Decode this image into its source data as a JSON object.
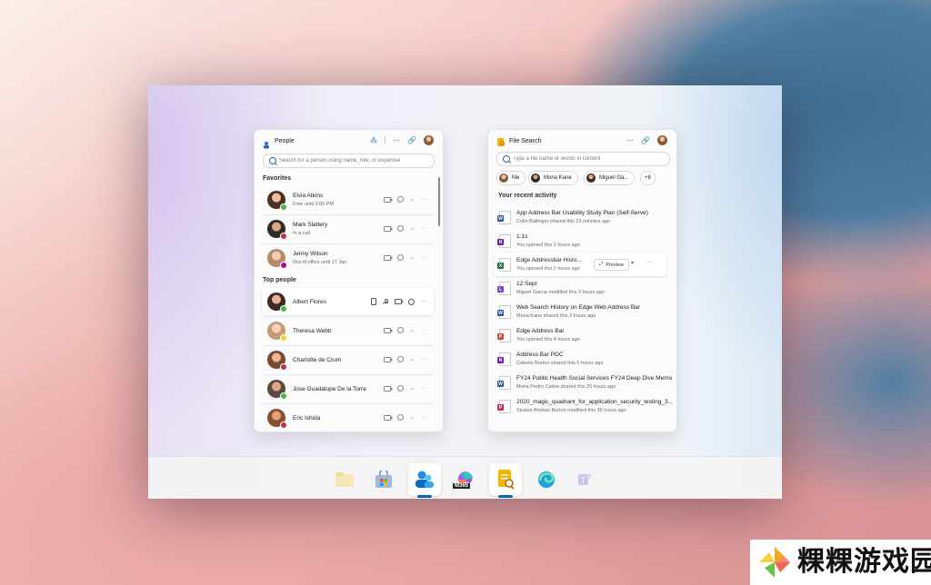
{
  "people": {
    "title": "People",
    "search_placeholder": "Search for a person using name, role, or expertise",
    "favorites_title": "Favorites",
    "favorites": [
      {
        "name": "Elvia Atkins",
        "status": "Free until 3:00 PM",
        "presence": "available"
      },
      {
        "name": "Mark Slattery",
        "status": "In a call",
        "presence": "busy"
      },
      {
        "name": "Jenny Wilson",
        "status": "Out of office until 17 Jan",
        "presence": "out-of-office"
      }
    ],
    "top_title": "Top people",
    "top": [
      {
        "name": "Albert Flores",
        "presence": "available"
      },
      {
        "name": "Theresa Webb",
        "presence": "away"
      },
      {
        "name": "Charlotte de Crum",
        "presence": "busy"
      },
      {
        "name": "Jose Guadalupe De la Torre",
        "presence": "available"
      },
      {
        "name": "Eric Ishida",
        "presence": "busy"
      }
    ]
  },
  "files": {
    "title": "File Search",
    "search_placeholder": "Type a file name or words in content",
    "chips": [
      "Me",
      "Mona Kane",
      "Miguel Ga...",
      "+8"
    ],
    "recent_title": "Your recent activity",
    "preview_label": "Preview",
    "items": [
      {
        "name": "App Address Bar Usability Study Plan (Self-Serve)",
        "meta": "Colin Ballinger shared this 23 minutes ago",
        "type": "word"
      },
      {
        "name": "1:1s",
        "meta": "You opened this 2 hours ago",
        "type": "onenote"
      },
      {
        "name": "Edge Addressbar Histo...",
        "meta": "You opened this 2 hours ago",
        "type": "excel"
      },
      {
        "name": "12 Sept",
        "meta": "Miguel Garcia modified this 3 hours ago",
        "type": "loop"
      },
      {
        "name": "Web Search History on Edge Web Address Bar",
        "meta": "Mona Kane shared this 3 hours ago",
        "type": "word"
      },
      {
        "name": "Edge Address Bar",
        "meta": "You opened this 4 hours ago",
        "type": "powerpoint"
      },
      {
        "name": "Address Bar POC",
        "meta": "Celeste Burton shared this 5 hours ago",
        "type": "onenote"
      },
      {
        "name": "FY24 Public Health Social Services FY24 Deep Dive Memo",
        "meta": "Mona Pedro Celine shared this 20 hours ago",
        "type": "word"
      },
      {
        "name": "2020_magic_quadrant_for_application_security_testing_3...",
        "meta": "Stratos Ahokas Burton modified this 36 hours ago",
        "type": "pdf"
      }
    ]
  },
  "taskbar": {
    "m365_label": "M365"
  },
  "watermark": {
    "text": "粿粿游戏园"
  },
  "colors": {
    "accent": "#0067c0",
    "word": "#2b579a",
    "excel": "#217346",
    "powerpoint": "#d24726",
    "onenote": "#7719aa"
  }
}
